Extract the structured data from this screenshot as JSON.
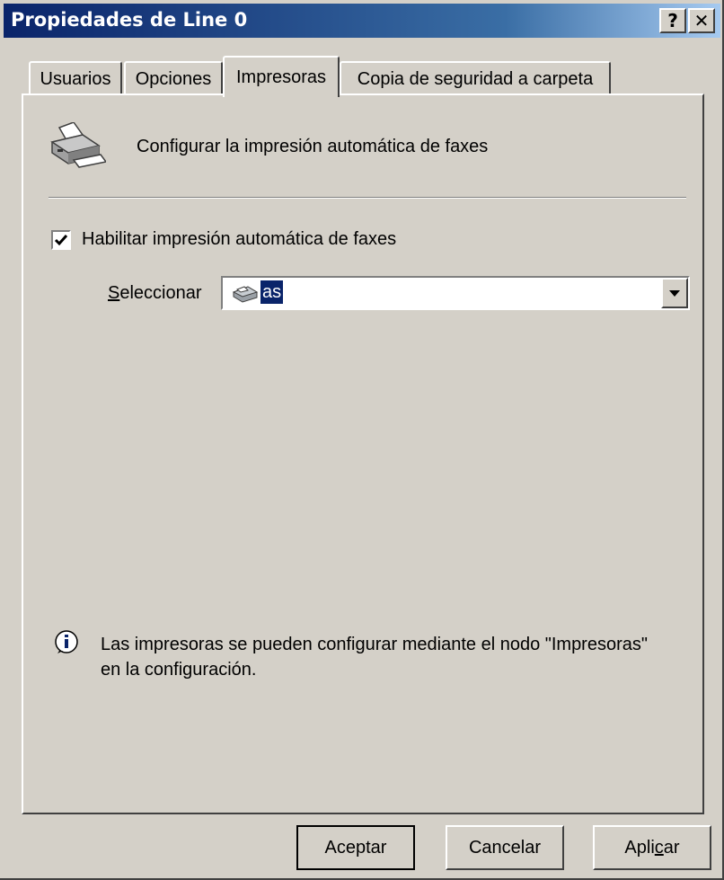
{
  "window": {
    "title": "Propiedades de Line 0"
  },
  "titlebar_buttons": {
    "help": "?",
    "close": "✕"
  },
  "tabs": [
    {
      "label": "Usuarios",
      "active": false
    },
    {
      "label": "Opciones",
      "active": false
    },
    {
      "label": "Impresoras",
      "active": true
    },
    {
      "label": "Copia de seguridad a carpeta",
      "active": false
    }
  ],
  "header": {
    "text": "Configurar la impresión automática de faxes",
    "icon": "printer-icon"
  },
  "enable_print": {
    "label": "Habilitar impresión automática de faxes",
    "checked": true
  },
  "select": {
    "label_hotkey": "S",
    "label_rest": "eleccionar",
    "value": "as",
    "icon": "printer-icon"
  },
  "info": {
    "icon": "info-icon",
    "line1": "Las impresoras se pueden configurar mediante el nodo \"Impresoras\"",
    "line2": "en la configuración."
  },
  "buttons": {
    "ok": "Aceptar",
    "cancel": "Cancelar",
    "apply_pre": "Apli",
    "apply_hotkey": "c",
    "apply_post": "ar"
  },
  "colors": {
    "face": "#d4d0c8",
    "titlebar": "#0a246a",
    "selection": "#0a246a"
  }
}
